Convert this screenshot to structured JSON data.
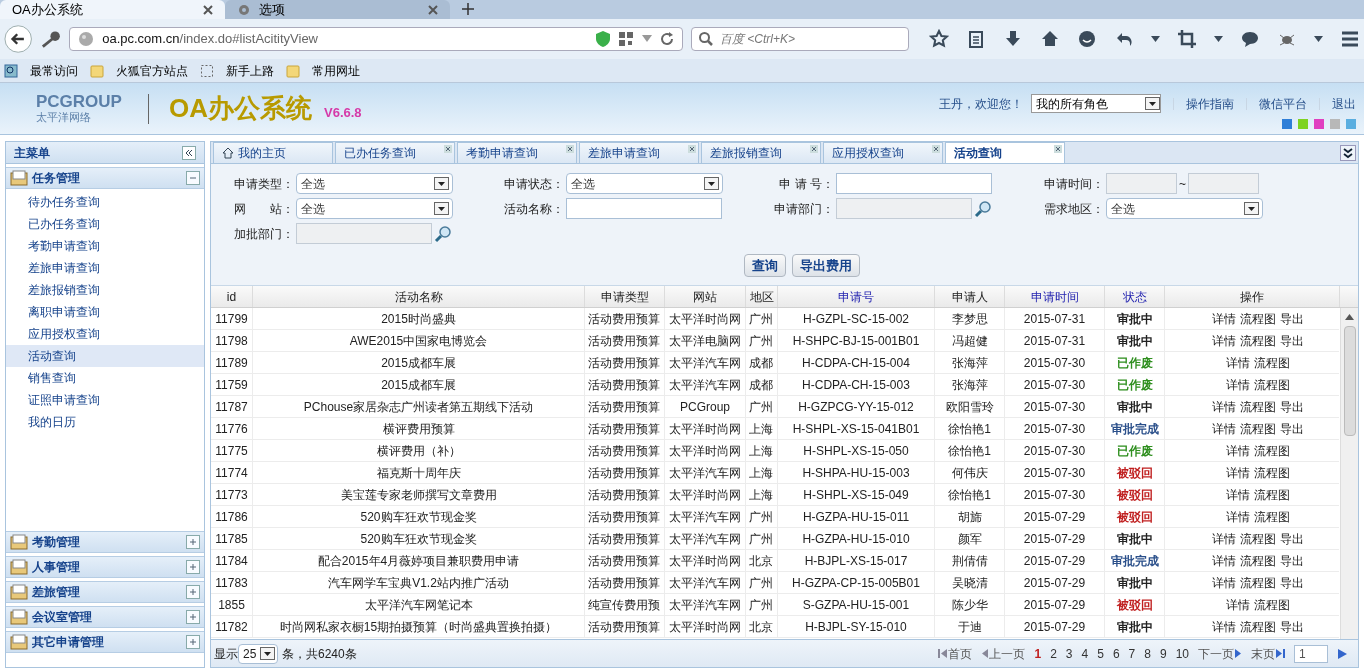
{
  "browser": {
    "tabs": [
      {
        "label": "OA办公系统",
        "selected": true,
        "kind": "page"
      },
      {
        "label": "选项",
        "selected": false,
        "kind": "settings"
      }
    ],
    "url": {
      "host": "oa.pc.com.cn",
      "path": "/index.do#listAcitityView"
    },
    "search": {
      "placeholder": "百度 <Ctrl+K>"
    },
    "bookmarks": [
      {
        "label": "最常访问",
        "kind": "special"
      },
      {
        "label": "火狐官方站点",
        "kind": "folder"
      },
      {
        "label": "新手上路",
        "kind": "blank"
      },
      {
        "label": "常用网址",
        "kind": "folder"
      }
    ]
  },
  "header": {
    "logo": "PCGROUP",
    "logo_sub": "太平洋网络",
    "title": "OA办公系统",
    "version": "V6.6.8",
    "welcome": "王丹，欢迎您！",
    "role_select": "我的所有角色",
    "links": [
      "操作指南",
      "微信平台",
      "退出"
    ],
    "themes": [
      {
        "color": "#2f7fd8"
      },
      {
        "color": "#7ed321"
      },
      {
        "color": "#e040c0"
      },
      {
        "color": "#b8b8b8"
      },
      {
        "color": "#5aaee0"
      }
    ]
  },
  "sidebar": {
    "title": "主菜单",
    "groups": [
      {
        "label": "任务管理",
        "expanded": true,
        "children": [
          {
            "label": "待办任务查询",
            "selected": false
          },
          {
            "label": "已办任务查询",
            "selected": false
          },
          {
            "label": "考勤申请查询",
            "selected": false
          },
          {
            "label": "差旅申请查询",
            "selected": false
          },
          {
            "label": "差旅报销查询",
            "selected": false
          },
          {
            "label": "离职申请查询",
            "selected": false
          },
          {
            "label": "应用授权查询",
            "selected": false
          },
          {
            "label": "活动查询",
            "selected": true
          },
          {
            "label": "销售查询",
            "selected": false
          },
          {
            "label": "证照申请查询",
            "selected": false
          },
          {
            "label": "我的日历",
            "selected": false
          }
        ]
      },
      {
        "label": "考勤管理",
        "expanded": false
      },
      {
        "label": "人事管理",
        "expanded": false
      },
      {
        "label": "差旅管理",
        "expanded": false
      },
      {
        "label": "会议室管理",
        "expanded": false
      },
      {
        "label": "其它申请管理",
        "expanded": false
      }
    ]
  },
  "tabs": [
    {
      "label": "我的主页",
      "selected": false,
      "closable": false
    },
    {
      "label": "已办任务查询",
      "selected": false,
      "closable": true
    },
    {
      "label": "考勤申请查询",
      "selected": false,
      "closable": true
    },
    {
      "label": "差旅申请查询",
      "selected": false,
      "closable": true
    },
    {
      "label": "差旅报销查询",
      "selected": false,
      "closable": true
    },
    {
      "label": "应用授权查询",
      "selected": false,
      "closable": true
    },
    {
      "label": "活动查询",
      "selected": true,
      "closable": true
    }
  ],
  "filters": [
    {
      "label": "申请类型：",
      "kind": "select",
      "value": "全选"
    },
    {
      "label": "申请状态：",
      "kind": "select",
      "value": "全选"
    },
    {
      "label": "申 请 号：",
      "kind": "text"
    },
    {
      "label": "申请时间：",
      "kind": "daterange",
      "separator": "~"
    },
    {
      "label": "网　　站：",
      "kind": "select",
      "value": "全选"
    },
    {
      "label": "活动名称：",
      "kind": "text"
    },
    {
      "label": "申请部门：",
      "kind": "lookup"
    },
    {
      "label": "需求地区：",
      "kind": "select",
      "value": "全选"
    },
    {
      "label": "加批部门：",
      "kind": "lookup"
    }
  ],
  "buttons": [
    "查询",
    "导出费用"
  ],
  "table": {
    "columns": [
      {
        "label": "id",
        "sortable": false
      },
      {
        "label": "活动名称",
        "sortable": false
      },
      {
        "label": "申请类型",
        "sortable": false
      },
      {
        "label": "网站",
        "sortable": false
      },
      {
        "label": "地区",
        "sortable": false
      },
      {
        "label": "申请号",
        "sortable": true
      },
      {
        "label": "申请人",
        "sortable": false
      },
      {
        "label": "申请时间",
        "sortable": true
      },
      {
        "label": "状态",
        "sortable": true
      },
      {
        "label": "操作",
        "sortable": false
      }
    ],
    "rows": [
      {
        "cells": [
          "11799",
          "2015时尚盛典",
          "活动费用预算",
          "太平洋时尚网",
          "广州",
          "H-GZPL-SC-15-002",
          "李梦思",
          "2015-07-31"
        ],
        "status": "审批中",
        "color": "#222222",
        "actions": [
          "详情",
          "流程图",
          "导出"
        ]
      },
      {
        "cells": [
          "11798",
          "AWE2015中国家电博览会",
          "活动费用预算",
          "太平洋电脑网",
          "广州",
          "H-SHPC-BJ-15-001B01",
          "冯超健",
          "2015-07-31"
        ],
        "status": "审批中",
        "color": "#222222",
        "actions": [
          "详情",
          "流程图",
          "导出"
        ]
      },
      {
        "cells": [
          "11789",
          "2015成都车展",
          "活动费用预算",
          "太平洋汽车网",
          "成都",
          "H-CDPA-CH-15-004",
          "张海萍",
          "2015-07-30"
        ],
        "status": "已作废",
        "color": "#2f8f1f",
        "actions": [
          "详情",
          "流程图"
        ]
      },
      {
        "cells": [
          "11759",
          "2015成都车展",
          "活动费用预算",
          "太平洋汽车网",
          "成都",
          "H-CDPA-CH-15-003",
          "张海萍",
          "2015-07-30"
        ],
        "status": "已作废",
        "color": "#2f8f1f",
        "actions": [
          "详情",
          "流程图"
        ]
      },
      {
        "cells": [
          "11787",
          "PChouse家居杂志广州读者第五期线下活动",
          "活动费用预算",
          "PCGroup",
          "广州",
          "H-GZPCG-YY-15-012",
          "欧阳雪玲",
          "2015-07-30"
        ],
        "status": "审批中",
        "color": "#222222",
        "actions": [
          "详情",
          "流程图",
          "导出"
        ]
      },
      {
        "cells": [
          "11776",
          "横评费用预算",
          "活动费用预算",
          "太平洋时尚网",
          "上海",
          "H-SHPL-XS-15-041B01",
          "徐怡艳1",
          "2015-07-30"
        ],
        "status": "审批完成",
        "color": "#2a4f8a",
        "actions": [
          "详情",
          "流程图",
          "导出"
        ]
      },
      {
        "cells": [
          "11775",
          "横评费用（补）",
          "活动费用预算",
          "太平洋时尚网",
          "上海",
          "H-SHPL-XS-15-050",
          "徐怡艳1",
          "2015-07-30"
        ],
        "status": "已作废",
        "color": "#2f8f1f",
        "actions": [
          "详情",
          "流程图"
        ]
      },
      {
        "cells": [
          "11774",
          "福克斯十周年庆",
          "活动费用预算",
          "太平洋汽车网",
          "上海",
          "H-SHPA-HU-15-003",
          "何伟庆",
          "2015-07-30"
        ],
        "status": "被驳回",
        "color": "#c02020",
        "actions": [
          "详情",
          "流程图"
        ]
      },
      {
        "cells": [
          "11773",
          "美宝莲专家老师撰写文章费用",
          "活动费用预算",
          "太平洋时尚网",
          "上海",
          "H-SHPL-XS-15-049",
          "徐怡艳1",
          "2015-07-30"
        ],
        "status": "被驳回",
        "color": "#c02020",
        "actions": [
          "详情",
          "流程图"
        ]
      },
      {
        "cells": [
          "11786",
          "520购车狂欢节现金奖",
          "活动费用预算",
          "太平洋汽车网",
          "广州",
          "H-GZPA-HU-15-011",
          "胡旆",
          "2015-07-29"
        ],
        "status": "被驳回",
        "color": "#c02020",
        "actions": [
          "详情",
          "流程图"
        ]
      },
      {
        "cells": [
          "11785",
          "520购车狂欢节现金奖",
          "活动费用预算",
          "太平洋汽车网",
          "广州",
          "H-GZPA-HU-15-010",
          "颜军",
          "2015-07-29"
        ],
        "status": "审批中",
        "color": "#222222",
        "actions": [
          "详情",
          "流程图",
          "导出"
        ]
      },
      {
        "cells": [
          "11784",
          "配合2015年4月薇婷项目兼职费用申请",
          "活动费用预算",
          "太平洋时尚网",
          "北京",
          "H-BJPL-XS-15-017",
          "荆倩倩",
          "2015-07-29"
        ],
        "status": "审批完成",
        "color": "#2a4f8a",
        "actions": [
          "详情",
          "流程图",
          "导出"
        ]
      },
      {
        "cells": [
          "11783",
          "汽车网学车宝典V1.2站内推广活动",
          "活动费用预算",
          "太平洋汽车网",
          "广州",
          "H-GZPA-CP-15-005B01",
          "吴晓清",
          "2015-07-29"
        ],
        "status": "审批中",
        "color": "#222222",
        "actions": [
          "详情",
          "流程图",
          "导出"
        ]
      },
      {
        "cells": [
          "1855",
          "太平洋汽车网笔记本",
          "纯宣传费用预",
          "太平洋汽车网",
          "广州",
          "S-GZPA-HU-15-001",
          "陈少华",
          "2015-07-29"
        ],
        "status": "被驳回",
        "color": "#c02020",
        "actions": [
          "详情",
          "流程图"
        ]
      },
      {
        "cells": [
          "11782",
          "时尚网私家衣橱15期拍摄预算（时尚盛典置换拍摄）",
          "活动费用预算",
          "太平洋时尚网",
          "北京",
          "H-BJPL-SY-15-010",
          "于迪",
          "2015-07-29"
        ],
        "status": "审批中",
        "color": "#222222",
        "actions": [
          "详情",
          "流程图",
          "导出"
        ]
      }
    ]
  },
  "pager": {
    "show_label": "显示",
    "page_size": "25",
    "total": "条，共6240条",
    "first": "首页",
    "prev": "上一页",
    "pages": [
      {
        "label": "1",
        "selected": true
      },
      {
        "label": "2",
        "selected": false
      },
      {
        "label": "3",
        "selected": false
      },
      {
        "label": "4",
        "selected": false
      },
      {
        "label": "5",
        "selected": false
      },
      {
        "label": "6",
        "selected": false
      },
      {
        "label": "7",
        "selected": false
      },
      {
        "label": "8",
        "selected": false
      },
      {
        "label": "9",
        "selected": false
      },
      {
        "label": "10",
        "selected": false
      }
    ],
    "next": "下一页",
    "last": "末页",
    "goto": "1"
  }
}
